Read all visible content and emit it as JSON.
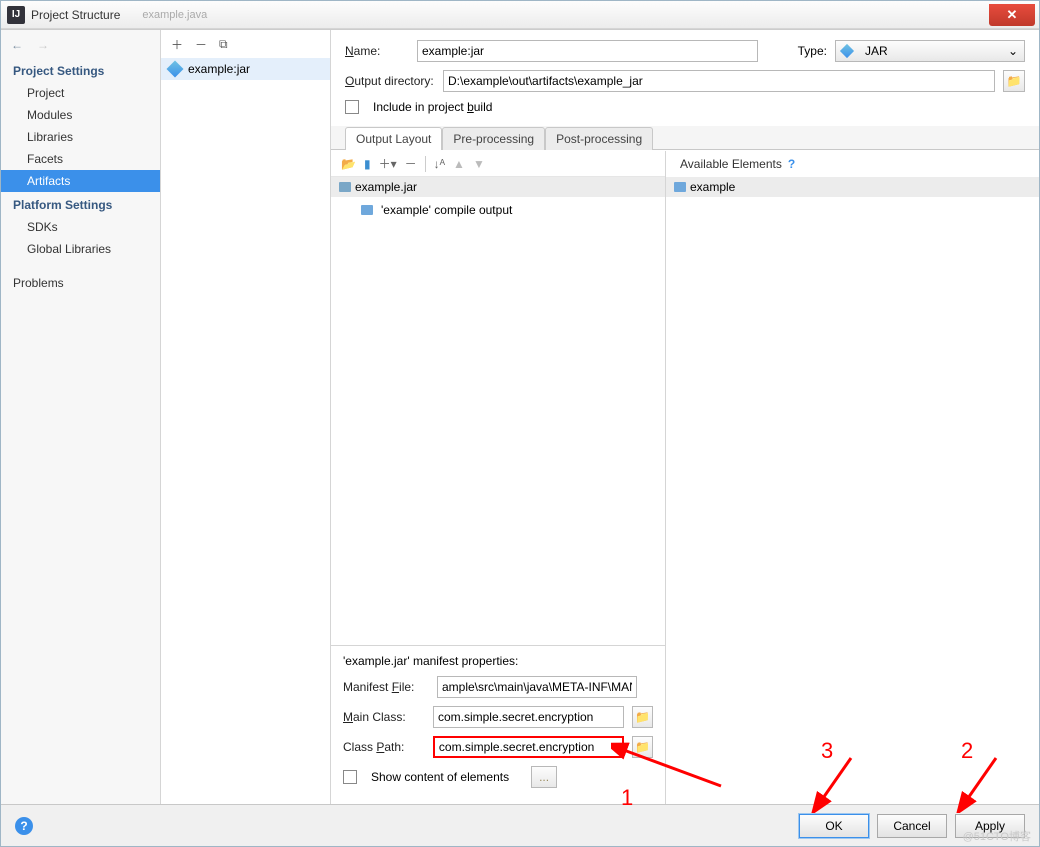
{
  "title": "Project Structure",
  "second_tab": "example.java",
  "nav": {
    "project_settings": "Project Settings",
    "items_ps": [
      "Project",
      "Modules",
      "Libraries",
      "Facets",
      "Artifacts"
    ],
    "platform_settings": "Platform Settings",
    "items_plat": [
      "SDKs",
      "Global Libraries"
    ],
    "problems": "Problems"
  },
  "mid": {
    "artifact": "example:jar"
  },
  "form": {
    "name_label": "Name:",
    "name_value": "example:jar",
    "type_label": "Type:",
    "type_value": "JAR",
    "outdir_label": "Output directory:",
    "outdir_value": "D:\\example\\out\\artifacts\\example_jar",
    "include_label": "Include in project build"
  },
  "tabs": {
    "t1": "Output Layout",
    "t2": "Pre-processing",
    "t3": "Post-processing"
  },
  "tree": {
    "root": "example.jar",
    "child": "'example' compile output"
  },
  "avail": {
    "heading": "Available Elements",
    "item": "example"
  },
  "manifest": {
    "heading": "'example.jar' manifest properties:",
    "file_label": "Manifest File:",
    "file_value": "ample\\src\\main\\java\\META-INF\\MANIFEST.MF",
    "main_label": "Main Class:",
    "main_value": "com.simple.secret.encryption",
    "cp_label": "Class Path:",
    "cp_value": "com.simple.secret.encryption",
    "show_label": "Show content of elements",
    "ellipsis": "..."
  },
  "buttons": {
    "ok": "OK",
    "cancel": "Cancel",
    "apply": "Apply"
  },
  "annot": {
    "a1": "1",
    "a2": "2",
    "a3": "3"
  },
  "watermark": "@51CTO博客"
}
